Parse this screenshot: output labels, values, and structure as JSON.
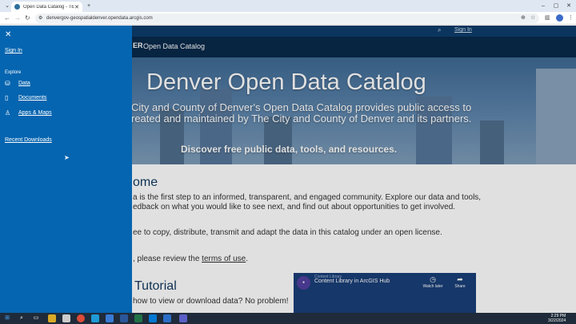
{
  "browser": {
    "tab_title": "Open Data Catalog - TEST",
    "tab_close": "✕",
    "new_tab": "+",
    "url": "denvergov-geospatialdenver.opendata.arcgis.com",
    "window_controls": [
      "–",
      "▢",
      "✕"
    ]
  },
  "topbar": {
    "sign_in": "Sign In",
    "search_icon": "search-icon"
  },
  "titlebar": {
    "logo": "ER",
    "name": "Open Data Catalog"
  },
  "hero": {
    "title": "Denver Open Data Catalog",
    "subtitle": "City and County of Denver's Open Data Catalog provides public access to\nreated and maintained by The City and County of Denver and its partners.",
    "discover": "Discover free public data, tools, and resources."
  },
  "content": {
    "welcome_heading": "ome",
    "welcome_text": "a is the first step to an informed, transparent, and engaged community. Explore our data and tools,\nedback on what you would like to see next, and find out about opportunities to get involved.",
    "license_text": "ee to copy, distribute, transmit and adapt the data in this catalog under an open license.",
    "terms_prefix": ", please review the ",
    "terms_link": "terms of use",
    "terms_suffix": ".",
    "tutorial_heading": "Tutorial",
    "tutorial_text": "how to view or download data? No problem!"
  },
  "video": {
    "channel": "Content Library",
    "title": "Content Library in ArcGIS Hub",
    "watch_later": "Watch later",
    "share": "Share"
  },
  "drawer": {
    "close_icon": "close-icon",
    "sign_in": "Sign In",
    "explore": "Explore",
    "items": [
      {
        "label": "Data",
        "icon": "database-icon"
      },
      {
        "label": "Documents",
        "icon": "document-icon"
      },
      {
        "label": "Apps & Maps",
        "icon": "user-icon"
      }
    ],
    "recent_downloads": "Recent Downloads"
  },
  "taskbar": {
    "time": "2:29 PM",
    "date": "3/22/2024"
  }
}
